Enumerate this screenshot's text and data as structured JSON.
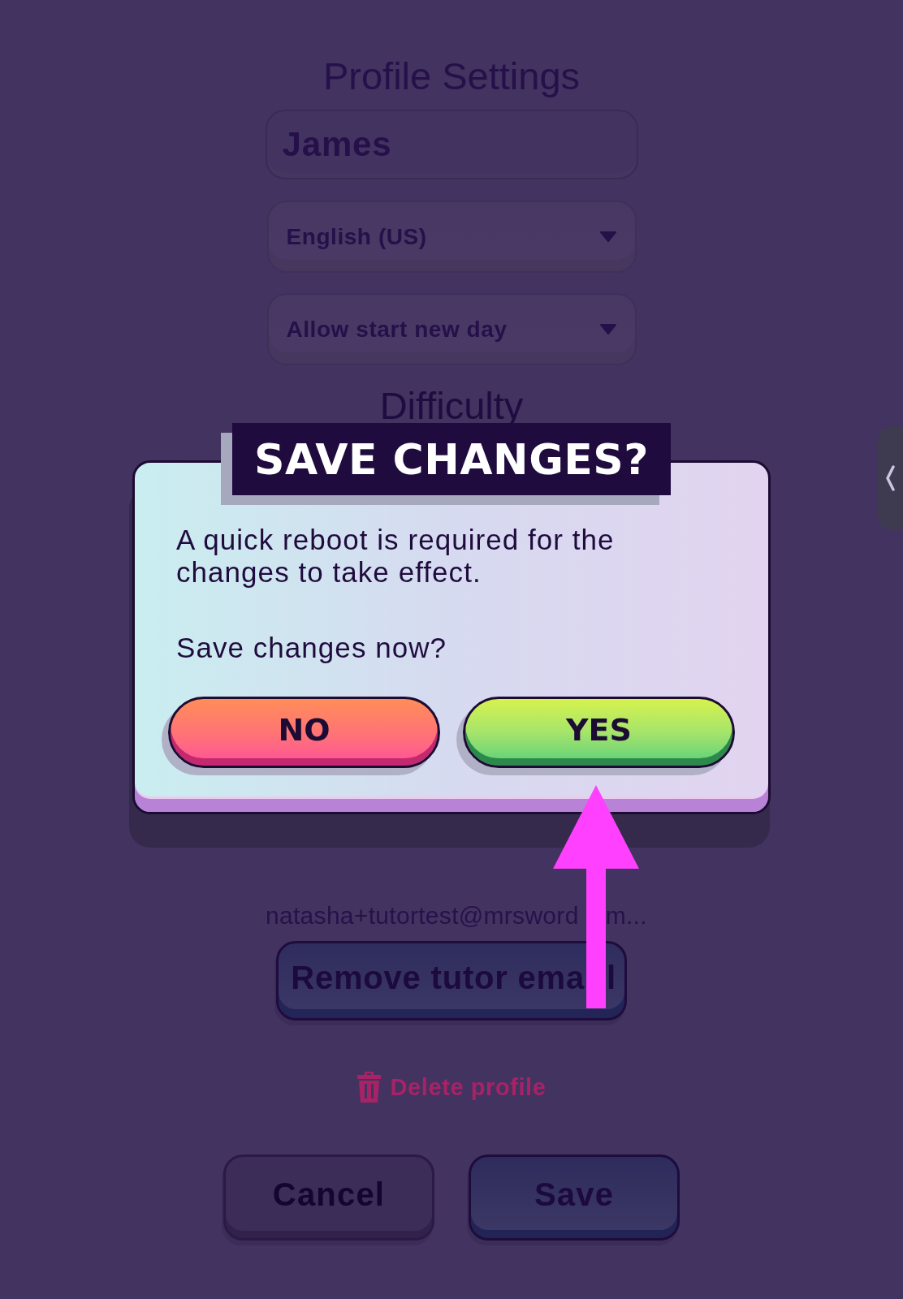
{
  "profile_settings": {
    "title": "Profile Settings",
    "name_field": {
      "value": "James"
    },
    "dropdowns": [
      {
        "value": "English (US)"
      },
      {
        "value": "Allow start new day"
      }
    ],
    "section_heading": "Difficulty",
    "tutor_email": {
      "text": "natasha+tutortest@mrsword",
      "text_after_arrow": "m..."
    },
    "remove_tutor_button": {
      "label": "Remove tutor ema",
      "label_after_arrow": "l"
    },
    "delete_profile": "Delete profile",
    "buttons": [
      {
        "label": "Cancel",
        "kind": "secondary"
      },
      {
        "label": "Save",
        "kind": "primary"
      }
    ]
  },
  "dialog": {
    "title": "SAVE CHANGES?",
    "message": "A quick reboot is required for the changes to take effect.",
    "question": "Save changes now?",
    "buttons": [
      {
        "label": "NO",
        "kind": "negative"
      },
      {
        "label": "YES",
        "kind": "positive"
      }
    ]
  }
}
